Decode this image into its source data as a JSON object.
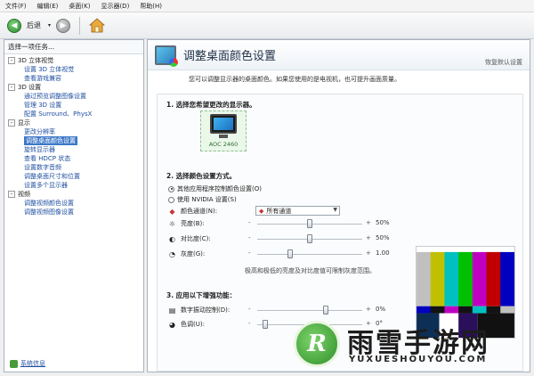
{
  "menu": [
    "文件(F)",
    "编辑(E)",
    "桌面(K)",
    "显示器(D)",
    "帮助(H)"
  ],
  "toolbar": {
    "back_label": "后退"
  },
  "sidebar": {
    "title": "选择一项任务...",
    "tree": [
      {
        "label": "3D 立体视觉",
        "level": 1,
        "expander": "-"
      },
      {
        "label": "设置 3D 立体视觉",
        "level": 2
      },
      {
        "label": "查看游戏兼容",
        "level": 2
      },
      {
        "label": "3D 设置",
        "level": 1,
        "expander": "-"
      },
      {
        "label": "通过预览调整图像设置",
        "level": 2
      },
      {
        "label": "管理 3D 设置",
        "level": 2
      },
      {
        "label": "配置 Surround、PhysX",
        "level": 2
      },
      {
        "label": "显示",
        "level": 1,
        "expander": "-"
      },
      {
        "label": "更改分辨率",
        "level": 2
      },
      {
        "label": "调整桌面颜色设置",
        "level": 2,
        "selected": true
      },
      {
        "label": "旋转显示器",
        "level": 2
      },
      {
        "label": "查看 HDCP 状态",
        "level": 2
      },
      {
        "label": "设置数字音频",
        "level": 2
      },
      {
        "label": "调整桌面尺寸和位置",
        "level": 2
      },
      {
        "label": "设置多个显示器",
        "level": 2
      },
      {
        "label": "视频",
        "level": 1,
        "expander": "-"
      },
      {
        "label": "调整视频颜色设置",
        "level": 2
      },
      {
        "label": "调整视频图像设置",
        "level": 2
      }
    ],
    "system_info": "系统信息"
  },
  "main": {
    "title": "调整桌面颜色设置",
    "restore": "恢复默认设置",
    "intro": "您可以调整显示器的桌面颜色。如果您使用的是电视机，也可提升画面质量。",
    "section1": {
      "title": "1.  选择您希望更改的显示器。",
      "display_label": "AOC 2460"
    },
    "section2": {
      "title": "2.  选择颜色设置方式。",
      "option1": "其他应用程序控制颜色设置(O)",
      "option2": "使用 NVIDIA 设置(S)",
      "channel_label": "颜色通道(N):",
      "channel_value": "所有通道",
      "rows": [
        {
          "icon": "☼",
          "label": "亮度(B):",
          "value": "50%",
          "level": 0.5
        },
        {
          "icon": "◐",
          "label": "对比度(C):",
          "value": "50%",
          "level": 0.5
        },
        {
          "icon": "◔",
          "label": "灰度(G):",
          "value": "1.00",
          "level": 0.3
        }
      ],
      "minus": "-",
      "plus": "+",
      "note": "极高和极低的亮度及对比度值可限制灰度范围。"
    },
    "section3": {
      "title": "3.  应用以下增强功能：",
      "rows": [
        {
          "label": "数字振动控制(D):",
          "value": "0%",
          "level": 0.66
        },
        {
          "label": "色调(U):",
          "value": "0°",
          "level": 0.05
        }
      ]
    }
  },
  "test_pattern": {
    "bars": [
      "#c0c0c0",
      "#c0c000",
      "#00c0c0",
      "#00c000",
      "#c000c0",
      "#c00000",
      "#0000c0"
    ],
    "bottom": [
      "#0000c0",
      "#131313",
      "#c000c0",
      "#131313",
      "#00c0c0",
      "#131313",
      "#c0c0c0"
    ]
  },
  "watermark": {
    "title": "雨雪手游网",
    "subtitle": "YUXUESHOUYOU.COM",
    "logo_letter": "R"
  }
}
